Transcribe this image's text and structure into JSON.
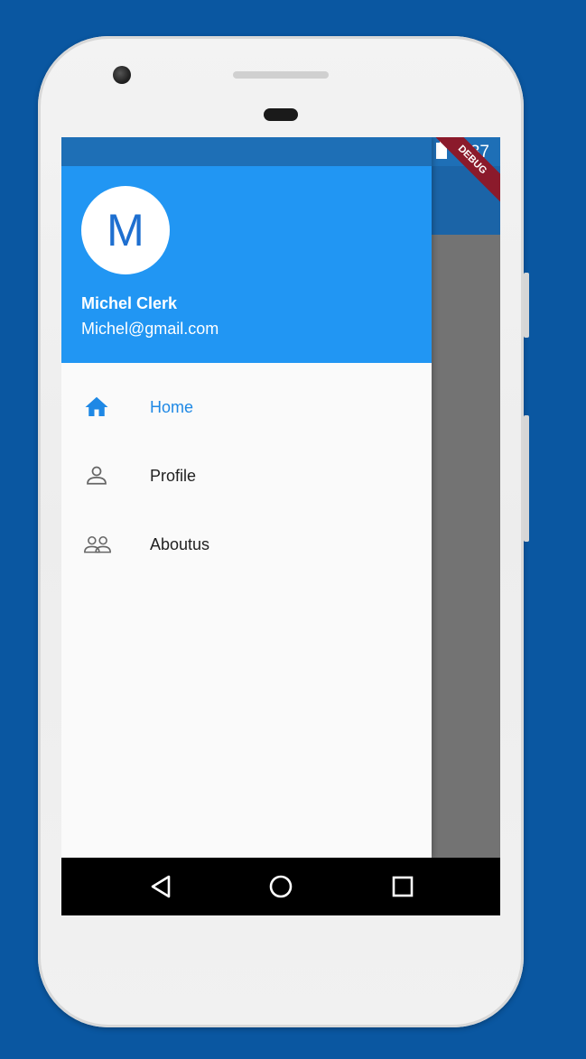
{
  "status_bar": {
    "time": "2:37",
    "icons": [
      "wifi-icon",
      "no-sim-icon",
      "battery-icon"
    ]
  },
  "debug_banner": "DEBUG",
  "drawer": {
    "avatar_initial": "M",
    "account_name": "Michel Clerk",
    "account_email": "Michel@gmail.com",
    "items": [
      {
        "label": "Home",
        "icon": "home-icon",
        "active": true
      },
      {
        "label": "Profile",
        "icon": "person-icon",
        "active": false
      },
      {
        "label": "Aboutus",
        "icon": "people-icon",
        "active": false
      }
    ]
  },
  "nav_bar": [
    "back-icon",
    "home-circle-icon",
    "recents-icon"
  ],
  "colors": {
    "background": "#0a57a1",
    "primary": "#2196f3",
    "status_bar": "#1e6fb6",
    "active_item": "#1e88e5",
    "scrim": "#737373"
  }
}
